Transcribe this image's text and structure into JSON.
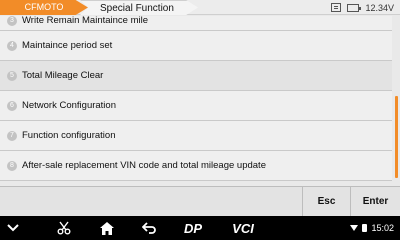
{
  "header": {
    "brand": "CFMOTO",
    "page": "Special Function",
    "voltage": "12.34V"
  },
  "list": {
    "items": [
      {
        "num": "3",
        "label": "Write Remain Maintaince mile"
      },
      {
        "num": "4",
        "label": "Maintaince period set"
      },
      {
        "num": "5",
        "label": "Total Mileage Clear"
      },
      {
        "num": "6",
        "label": "Network Configuration"
      },
      {
        "num": "7",
        "label": "Function configuration"
      },
      {
        "num": "8",
        "label": "After-sale replacement VIN code and total mileage update"
      }
    ]
  },
  "actions": {
    "esc": "Esc",
    "enter": "Enter"
  },
  "navbar": {
    "dp": "DP",
    "vci": "VCI",
    "time": "15:02"
  },
  "colors": {
    "accent": "#f28c28",
    "navbar": "#000000"
  }
}
